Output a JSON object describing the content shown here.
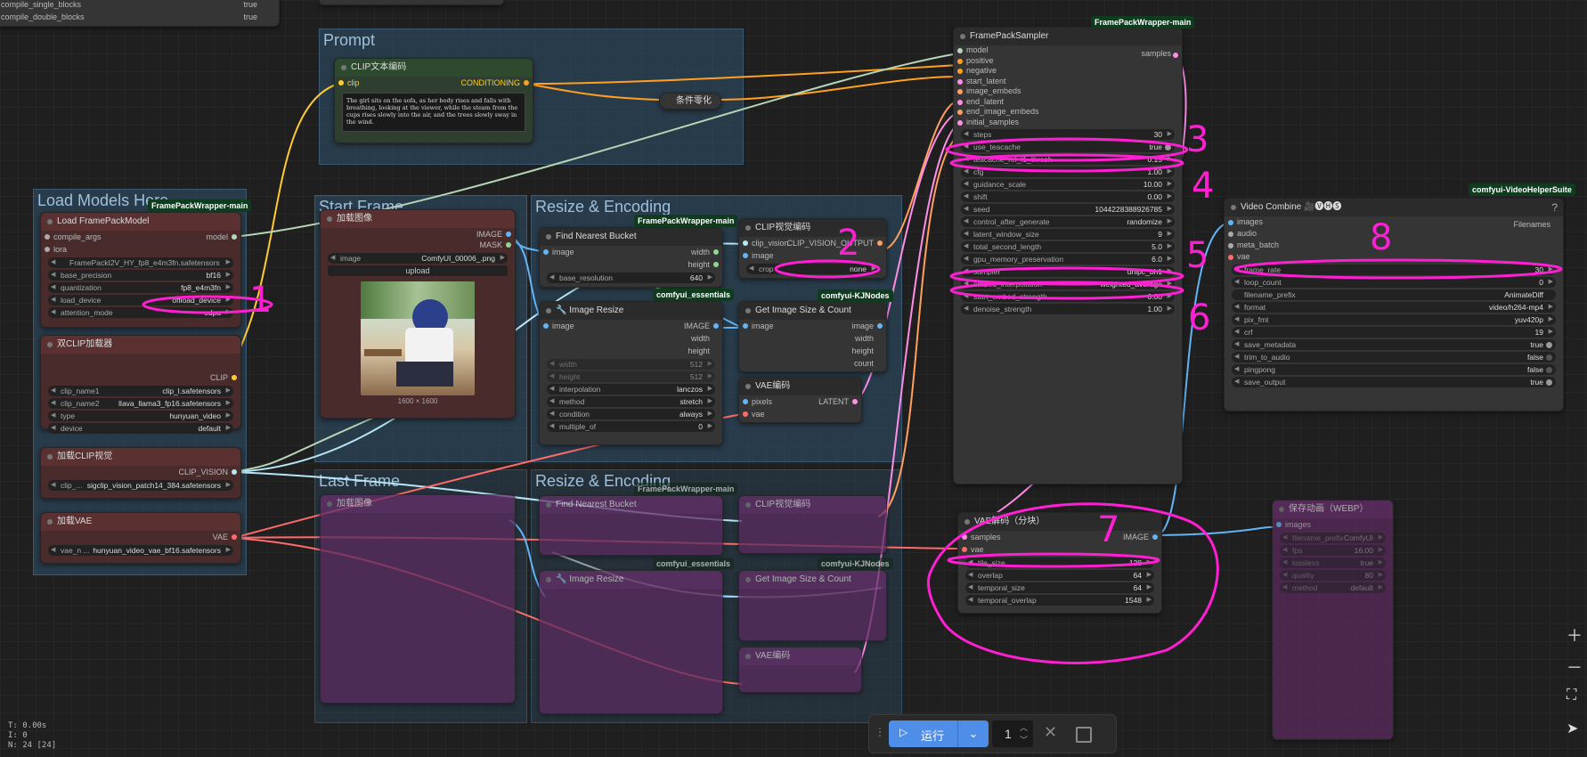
{
  "canvas": {
    "bg": "#1f1f1f"
  },
  "top_left": {
    "compile_single_blocks": "compile_single_blocks",
    "compile_single_val": "true",
    "compile_double_blocks": "compile_double_blocks",
    "compile_double_val": "true"
  },
  "groups": {
    "prompt": "Prompt",
    "load_models": "Load Models Here",
    "start_frame": "Start Frame",
    "resize1": "Resize & Encoding",
    "last_frame": "Last Frame",
    "resize2": "Resize & Encoding"
  },
  "badges": {
    "fpw": "FramePackWrapper-main",
    "essentials": "comfyui_essentials",
    "kj": "comfyui-KJNodes",
    "vhs": "comfyui-VideoHelperSuite"
  },
  "clip_text": {
    "title": "CLIP文本编码",
    "in_clip": "clip",
    "out": "CONDITIONING",
    "text": "The girl sits on the sofa, as her body rises and falls with breathing, looking at the viewer, while the steam from the cups rises slowly into the air, and the trees slowly sway in the wind."
  },
  "cond_zero": {
    "title": "条件零化"
  },
  "load_fp": {
    "title": "Load FramePackModel",
    "in1": "compile_args",
    "in2": "lora",
    "out": "model",
    "model": "FramePackI2V_HY_fp8_e4m3fn.safetensors",
    "base_precision_l": "base_precision",
    "base_precision_v": "bf16",
    "quantization_l": "quantization",
    "quantization_v": "fp8_e4m3fn",
    "load_device_l": "load_device",
    "load_device_v": "offload_device",
    "attention_mode_l": "attention_mode",
    "attention_mode_v": "sdpa"
  },
  "dual_clip": {
    "title": "双CLIP加载器",
    "out": "CLIP",
    "clip_name1_l": "clip_name1",
    "clip_name1_v": "clip_l.safetensors",
    "clip_name2_l": "clip_name2",
    "clip_name2_v": "llava_llama3_fp16.safetensors",
    "type_l": "type",
    "type_v": "hunyuan_video",
    "device_l": "device",
    "device_v": "default"
  },
  "clip_vision_loader": {
    "title": "加载CLIP视觉",
    "out": "CLIP_VISION",
    "clip_l": "clip_...",
    "clip_v": "sigclip_vision_patch14_384.safetensors"
  },
  "vae_loader": {
    "title": "加载VAE",
    "out": "VAE",
    "vae_l": "vae_n ...",
    "vae_v": "hunyuan_video_vae_bf16.safetensors"
  },
  "load_image": {
    "title": "加载图像",
    "out1": "IMAGE",
    "out2": "MASK",
    "image_l": "image",
    "image_v": "ComfyUI_00006_.png",
    "upload": "upload",
    "size": "1600 × 1600"
  },
  "find_bucket": {
    "title": "Find Nearest Bucket",
    "in": "image",
    "out1": "width",
    "out2": "height",
    "base_res_l": "base_resolution",
    "base_res_v": "640"
  },
  "image_resize": {
    "title": "🔧 Image Resize",
    "in": "image",
    "o1": "IMAGE",
    "o2": "width",
    "o3": "height",
    "width_l": "width",
    "width_v": "512",
    "height_l": "height",
    "height_v": "512",
    "interp_l": "interpolation",
    "interp_v": "lanczos",
    "method_l": "method",
    "method_v": "stretch",
    "cond_l": "condition",
    "cond_v": "always",
    "mult_l": "multiple_of",
    "mult_v": "0"
  },
  "clip_vision_enc": {
    "title": "CLIP视觉编码",
    "in1": "clip_vision",
    "in2": "image",
    "out": "CLIP_VISION_OUTPUT",
    "crop_l": "crop",
    "crop_v": "none"
  },
  "get_image_size": {
    "title": "Get Image Size & Count",
    "in": "image",
    "o1": "image",
    "o2": "width",
    "o3": "height",
    "o4": "count"
  },
  "vae_encode": {
    "title": "VAE编码",
    "in1": "pixels",
    "in2": "vae",
    "out": "LATENT"
  },
  "sampler": {
    "title": "FramePackSampler",
    "out": "samples",
    "inputs": [
      "model",
      "positive",
      "negative",
      "start_latent",
      "image_embeds",
      "end_latent",
      "end_image_embeds",
      "initial_samples"
    ],
    "widgets": [
      {
        "l": "steps",
        "v": "30"
      },
      {
        "l": "use_teacache",
        "v": "true"
      },
      {
        "l": "teacache_rel_l1_thresh",
        "v": "0.15"
      },
      {
        "l": "cfg",
        "v": "1.00"
      },
      {
        "l": "guidance_scale",
        "v": "10.00"
      },
      {
        "l": "shift",
        "v": "0.00"
      },
      {
        "l": "seed",
        "v": "1044228388926785"
      },
      {
        "l": "control_after_generate",
        "v": "randomize"
      },
      {
        "l": "latent_window_size",
        "v": "9"
      },
      {
        "l": "total_second_length",
        "v": "5.0"
      },
      {
        "l": "gpu_memory_preservation",
        "v": "6.0"
      },
      {
        "l": "sampler",
        "v": "unipc_bh1"
      },
      {
        "l": "embed_interpolation",
        "v": "weighted_average"
      },
      {
        "l": "start_embed_strength",
        "v": "0.00"
      },
      {
        "l": "denoise_strength",
        "v": "1.00"
      }
    ]
  },
  "vae_decode": {
    "title": "VAE解码（分块）",
    "in1": "samples",
    "in2": "vae",
    "out": "IMAGE",
    "widgets": [
      {
        "l": "tile_size",
        "v": "128"
      },
      {
        "l": "overlap",
        "v": "64"
      },
      {
        "l": "temporal_size",
        "v": "64"
      },
      {
        "l": "temporal_overlap",
        "v": "1548"
      }
    ]
  },
  "video_combine": {
    "title": "Video Combine 🎥🅥🅗🅢",
    "out": "Filenames",
    "inputs": [
      "images",
      "audio",
      "meta_batch",
      "vae"
    ],
    "widgets": [
      {
        "l": "frame_rate",
        "v": "30"
      },
      {
        "l": "loop_count",
        "v": "0"
      },
      {
        "l": "filename_prefix",
        "v": "AnimateDiff"
      },
      {
        "l": "format",
        "v": "video/h264-mp4"
      },
      {
        "l": "pix_fmt",
        "v": "yuv420p"
      },
      {
        "l": "crf",
        "v": "19"
      },
      {
        "l": "save_metadata",
        "v": "true"
      },
      {
        "l": "trim_to_audio",
        "v": "false"
      },
      {
        "l": "pingpong",
        "v": "false"
      },
      {
        "l": "save_output",
        "v": "true"
      }
    ]
  },
  "save_webp": {
    "title": "保存动画（WEBP）",
    "in": "images",
    "widgets": [
      {
        "l": "filename_prefix",
        "v": "ComfyUI"
      },
      {
        "l": "fps",
        "v": "16.00"
      },
      {
        "l": "lossless",
        "v": "true"
      },
      {
        "l": "quality",
        "v": "80"
      },
      {
        "l": "method",
        "v": "default"
      }
    ]
  },
  "annotations": [
    "1",
    "2",
    "3",
    "4",
    "5",
    "6",
    "7",
    "8"
  ],
  "toolbar": {
    "run_label": "运行",
    "batch": "1"
  },
  "stats": {
    "t": "T: 0.00s",
    "i": "I: 0",
    "n": "N: 24 [24]"
  },
  "colors": {
    "accent": "#ff1fd2",
    "run": "#4e8de8"
  }
}
